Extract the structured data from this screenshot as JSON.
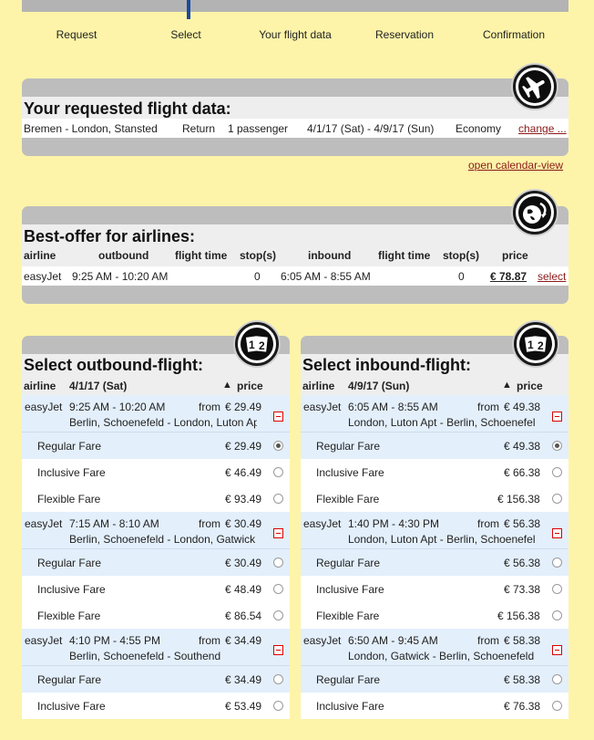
{
  "steps": [
    "Request",
    "Select",
    "Your flight data",
    "Reservation",
    "Confirmation"
  ],
  "request": {
    "title": "Your requested flight data:",
    "route": "Bremen - London, Stansted",
    "trip_type": "Return",
    "passengers": "1  passenger",
    "dates": "4/1/17 (Sat)  -  4/9/17 (Sun)",
    "cabin": "Economy",
    "change_link": "change ...",
    "icon": "airplane-icon"
  },
  "calendar_link": "open calendar-view",
  "best_offer": {
    "title": "Best-offer for airlines:",
    "icon": "globe-arrow-icon",
    "headers": {
      "airline": "airline",
      "outbound": "outbound",
      "flight_time_out": "flight time",
      "stops_out": "stop(s)",
      "inbound": "inbound",
      "flight_time_in": "flight time",
      "stops_in": "stop(s)",
      "price": "price"
    },
    "row": {
      "airline": "easyJet",
      "outbound": "9:25 AM - 10:20 AM",
      "stops_out": "0",
      "inbound": "6:05 AM - 8:55 AM",
      "stops_in": "0",
      "price": "€ 78.87",
      "select": "select"
    }
  },
  "outbound": {
    "title": "Select outbound-flight:",
    "icon": "step-1-2-icon",
    "airline_header": "airline",
    "date": "4/1/17 (Sat)",
    "price_header": "price",
    "flights": [
      {
        "airline": "easyJet",
        "times": "9:25 AM  -  10:20 AM",
        "from": "from",
        "price": "€ 29.49",
        "route": "Berlin, Schoenefeld  -  London, Luton Apt",
        "fares": [
          {
            "name": "Regular Fare",
            "price": "€ 29.49",
            "checked": true
          },
          {
            "name": "Inclusive Fare",
            "price": "€ 46.49",
            "checked": false
          },
          {
            "name": "Flexible Fare",
            "price": "€ 93.49",
            "checked": false
          }
        ]
      },
      {
        "airline": "easyJet",
        "times": "7:15 AM  -  8:10 AM",
        "from": "from",
        "price": "€ 30.49",
        "route": "Berlin, Schoenefeld  -  London, Gatwick",
        "fares": [
          {
            "name": "Regular Fare",
            "price": "€ 30.49",
            "checked": false
          },
          {
            "name": "Inclusive Fare",
            "price": "€ 48.49",
            "checked": false
          },
          {
            "name": "Flexible Fare",
            "price": "€ 86.54",
            "checked": false
          }
        ]
      },
      {
        "airline": "easyJet",
        "times": "4:10 PM  -  4:55 PM",
        "from": "from",
        "price": "€ 34.49",
        "route": "Berlin, Schoenefeld  -  Southend",
        "fares": [
          {
            "name": "Regular Fare",
            "price": "€ 34.49",
            "checked": false
          },
          {
            "name": "Inclusive Fare",
            "price": "€ 53.49",
            "checked": false
          }
        ]
      }
    ]
  },
  "inbound": {
    "title": "Select inbound-flight:",
    "icon": "step-1-2-icon",
    "airline_header": "airline",
    "date": "4/9/17 (Sun)",
    "price_header": "price",
    "flights": [
      {
        "airline": "easyJet",
        "times": "6:05 AM  -  8:55 AM",
        "from": "from",
        "price": "€ 49.38",
        "route": "London, Luton Apt  -  Berlin, Schoenefeld",
        "fares": [
          {
            "name": "Regular Fare",
            "price": "€ 49.38",
            "checked": true
          },
          {
            "name": "Inclusive Fare",
            "price": "€ 66.38",
            "checked": false
          },
          {
            "name": "Flexible Fare",
            "price": "€ 156.38",
            "checked": false
          }
        ]
      },
      {
        "airline": "easyJet",
        "times": "1:40 PM  -  4:30 PM",
        "from": "from",
        "price": "€ 56.38",
        "route": "London, Luton Apt  -  Berlin, Schoenefeld",
        "fares": [
          {
            "name": "Regular Fare",
            "price": "€ 56.38",
            "checked": false
          },
          {
            "name": "Inclusive Fare",
            "price": "€ 73.38",
            "checked": false
          },
          {
            "name": "Flexible Fare",
            "price": "€ 156.38",
            "checked": false
          }
        ]
      },
      {
        "airline": "easyJet",
        "times": "6:50 AM  -  9:45 AM",
        "from": "from",
        "price": "€ 58.38",
        "route": "London, Gatwick  -  Berlin, Schoenefeld",
        "fares": [
          {
            "name": "Regular Fare",
            "price": "€ 58.38",
            "checked": false
          },
          {
            "name": "Inclusive Fare",
            "price": "€ 76.38",
            "checked": false
          }
        ]
      }
    ]
  }
}
